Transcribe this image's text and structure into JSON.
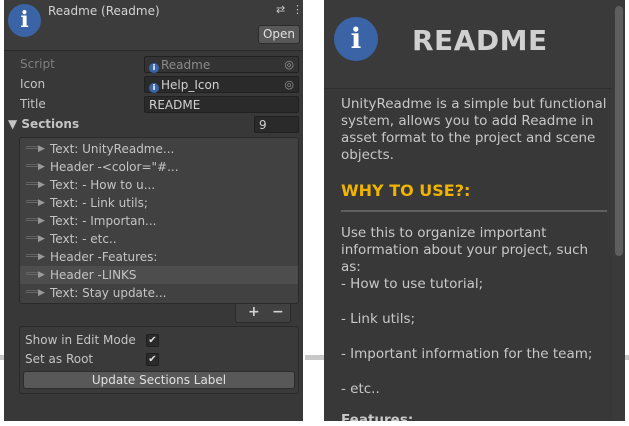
{
  "inspector": {
    "title": "Readme (Readme)",
    "open_label": "Open",
    "fields": {
      "script_label": "Script",
      "script_value": "Readme",
      "icon_label": "Icon",
      "icon_value": "Help_Icon",
      "title_label": "Title",
      "title_value": "README"
    },
    "sections_label": "Sections",
    "sections_count": "9",
    "sections": [
      {
        "label": "Text: UnityReadme..."
      },
      {
        "label": "Header -<color=\"#..."
      },
      {
        "label": "Text: -  How to u..."
      },
      {
        "label": "Text: -  Link utils;"
      },
      {
        "label": "Text: -  Importan..."
      },
      {
        "label": "Text: -  etc.."
      },
      {
        "label": "Header -Features:"
      },
      {
        "label": "Header -LINKS"
      },
      {
        "label": "Text: Stay update..."
      }
    ],
    "add_symbol": "+",
    "remove_symbol": "−",
    "show_in_edit_mode_label": "Show in Edit Mode",
    "set_as_root_label": "Set as Root",
    "update_button_label": "Update Sections Label"
  },
  "readme": {
    "title": "README",
    "intro": "UnityReadme is a simple but functional system, allows you to add Readme in asset format to the project and scene objects.",
    "heading": "WHY TO USE?:",
    "lead": "Use this to organize important information about your project, such as:",
    "items": [
      "-  How to use tutorial;",
      "-  Link utils;",
      "-  Important information for the team;",
      "-  etc.."
    ],
    "cut_text": "Features:"
  },
  "colors": {
    "accent_icon": "#3a64a6",
    "heading": "#f0b400",
    "panel_bg": "#383838"
  },
  "icons": [
    "info-icon",
    "settings-icon",
    "menu-icon",
    "target-icon",
    "drag-handle-icon",
    "expand-arrow-icon",
    "check-icon"
  ]
}
